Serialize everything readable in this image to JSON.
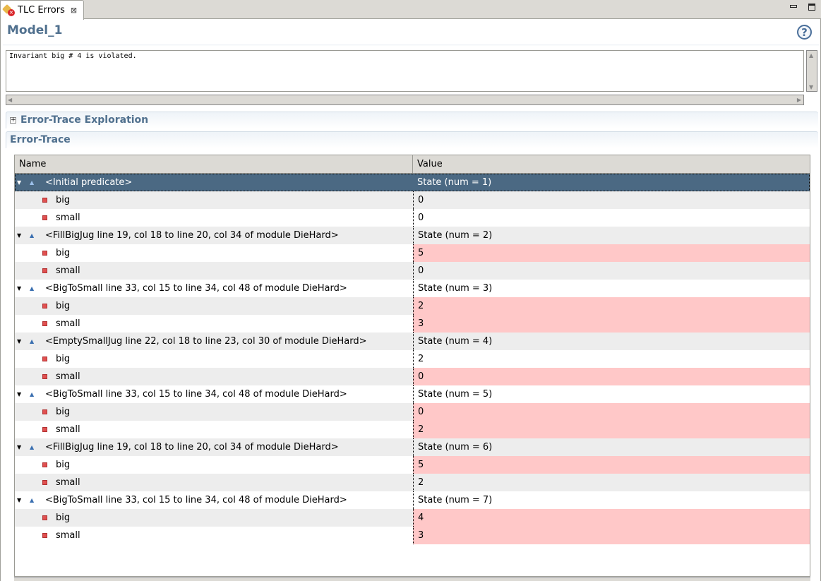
{
  "tab": {
    "title": "TLC Errors",
    "close_icon": "close-icon",
    "icon": "tlc-error-icon"
  },
  "header": {
    "title": "Model_1",
    "help_icon": "help-icon",
    "help_glyph": "?"
  },
  "message": "Invariant big # 4 is violated.",
  "sections": {
    "exploration": "Error-Trace Exploration",
    "trace": "Error-Trace"
  },
  "table": {
    "columns": [
      "Name",
      "Value"
    ],
    "colors": {
      "selected": "#4b6983",
      "changed": "#ffc8c8",
      "alt_row": "#ededed"
    },
    "states": [
      {
        "name": "<Initial predicate>",
        "value": "State (num = 1)",
        "vars": [
          {
            "name": "big",
            "value": "0",
            "changed": false
          },
          {
            "name": "small",
            "value": "0",
            "changed": false
          }
        ]
      },
      {
        "name": "<FillBigJug line 19, col 18 to line 20, col 34 of module DieHard>",
        "value": "State (num = 2)",
        "vars": [
          {
            "name": "big",
            "value": "5",
            "changed": true
          },
          {
            "name": "small",
            "value": "0",
            "changed": false
          }
        ]
      },
      {
        "name": "<BigToSmall line 33, col 15 to line 34, col 48 of module DieHard>",
        "value": "State (num = 3)",
        "vars": [
          {
            "name": "big",
            "value": "2",
            "changed": true
          },
          {
            "name": "small",
            "value": "3",
            "changed": true
          }
        ]
      },
      {
        "name": "<EmptySmallJug line 22, col 18 to line 23, col 30 of module DieHard>",
        "value": "State (num = 4)",
        "vars": [
          {
            "name": "big",
            "value": "2",
            "changed": false
          },
          {
            "name": "small",
            "value": "0",
            "changed": true
          }
        ]
      },
      {
        "name": "<BigToSmall line 33, col 15 to line 34, col 48 of module DieHard>",
        "value": "State (num = 5)",
        "vars": [
          {
            "name": "big",
            "value": "0",
            "changed": true
          },
          {
            "name": "small",
            "value": "2",
            "changed": true
          }
        ]
      },
      {
        "name": "<FillBigJug line 19, col 18 to line 20, col 34 of module DieHard>",
        "value": "State (num = 6)",
        "vars": [
          {
            "name": "big",
            "value": "5",
            "changed": true
          },
          {
            "name": "small",
            "value": "2",
            "changed": false
          }
        ]
      },
      {
        "name": "<BigToSmall line 33, col 15 to line 34, col 48 of module DieHard>",
        "value": "State (num = 7)",
        "vars": [
          {
            "name": "big",
            "value": "4",
            "changed": true
          },
          {
            "name": "small",
            "value": "3",
            "changed": true
          }
        ]
      }
    ]
  }
}
